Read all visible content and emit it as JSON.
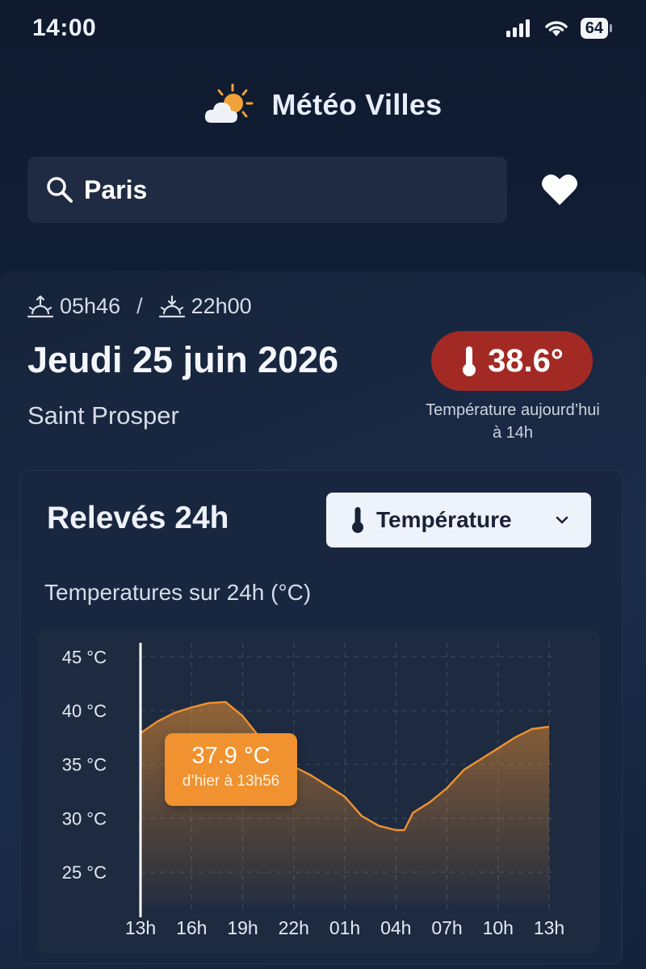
{
  "status_bar": {
    "time": "14:00",
    "battery": "64"
  },
  "header": {
    "title": "Météo Villes",
    "logo_icon": "sun-cloud-icon"
  },
  "search": {
    "value": "Paris",
    "icon": "search-icon"
  },
  "favorite": {
    "icon": "heart-icon"
  },
  "day": {
    "sunrise": "05h46",
    "separator": "/",
    "sunset": "22h00",
    "date": "Jeudi 25 juin 2026",
    "saint": "Saint Prosper",
    "temperature": "38.6°",
    "temperature_caption_line1": "Température aujourd’hui",
    "temperature_caption_line2": "à 14h"
  },
  "readings": {
    "title": "Relevés 24h",
    "selected_metric": "Température",
    "chart_subtitle": "Temperatures sur 24h (°C)",
    "tooltip_value": "37.9 °C",
    "tooltip_sub": "d’hier à 13h56"
  },
  "colors": {
    "accent": "#f0922f",
    "badge": "#a32a24",
    "background": "#0f1a2e"
  },
  "chart_data": {
    "type": "area",
    "title": "Temperatures sur 24h (°C)",
    "x_ticks": [
      "13h",
      "16h",
      "19h",
      "22h",
      "01h",
      "04h",
      "07h",
      "10h",
      "13h"
    ],
    "y_ticks": [
      "45 °C",
      "40 °C",
      "35 °C",
      "30 °C",
      "25 °C"
    ],
    "ylim": [
      22,
      46
    ],
    "x_hours_since_13h": [
      0,
      1,
      2,
      3,
      4,
      5,
      6,
      7,
      8,
      9,
      10,
      11,
      12,
      13,
      14,
      15,
      15.5,
      16,
      17,
      18,
      19,
      20,
      21,
      22,
      23,
      24
    ],
    "values": [
      37.9,
      39.0,
      39.8,
      40.3,
      40.7,
      40.8,
      39.5,
      37.5,
      35.5,
      34.8,
      34.0,
      33.0,
      32.0,
      30.2,
      29.3,
      28.9,
      28.9,
      30.5,
      31.5,
      32.8,
      34.5,
      35.5,
      36.5,
      37.5,
      38.3,
      38.5
    ],
    "grid": true,
    "cursor": {
      "x": "13h",
      "value": 37.9
    }
  }
}
